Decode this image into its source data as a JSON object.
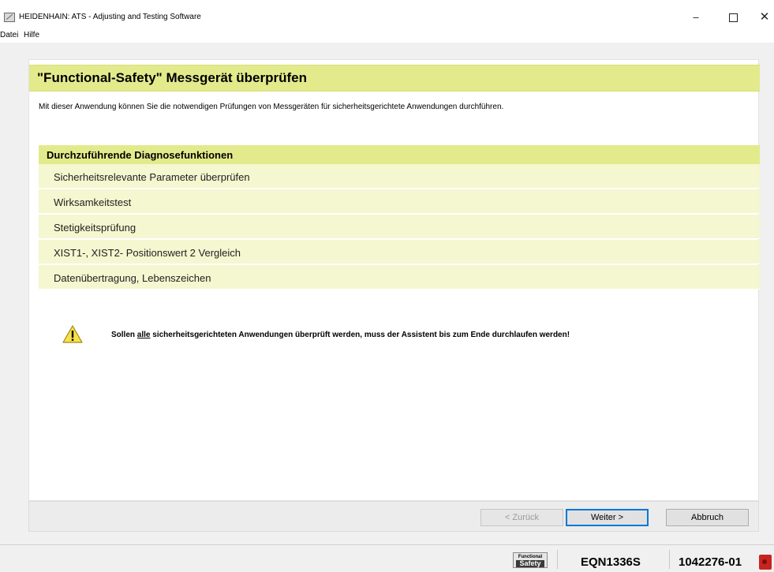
{
  "window": {
    "title": "HEIDENHAIN: ATS - Adjusting and Testing Software",
    "controls": {
      "minimize": "–",
      "close": "✕"
    }
  },
  "menubar": {
    "items": [
      "Datei",
      "Hilfe"
    ]
  },
  "main": {
    "heading": "\"Functional-Safety\" Messgerät überprüfen",
    "intro": "Mit dieser Anwendung können Sie die notwendigen Prüfungen von Messgeräten für sicherheitsgerichtete Anwendungen durchführen.",
    "diagnostics": {
      "header": "Durchzuführende Diagnosefunktionen",
      "items": [
        "Sicherheitsrelevante Parameter überprüfen",
        "Wirksamkeitstest",
        "Stetigkeitsprüfung",
        "XIST1-, XIST2- Positionswert 2 Vergleich",
        "Datenübertragung, Lebenszeichen"
      ]
    },
    "warning": {
      "before": "Sollen ",
      "emphasis": "alle",
      "after": " sicherheitsgerichteten Anwendungen überprüft werden, muss der Assistent bis zum Ende durchlaufen werden!"
    }
  },
  "buttons": {
    "back": "< Zurück",
    "next": "Weiter >",
    "cancel": "Abbruch"
  },
  "statusbar": {
    "badge_line1": "Functional",
    "badge_line2": "Safety",
    "device": "EQN1336S",
    "serial": "1042276-01"
  },
  "colors": {
    "accent_band": "#e3ea8c",
    "row_background": "#f4f7cf",
    "status_icon": "#c8241f"
  }
}
